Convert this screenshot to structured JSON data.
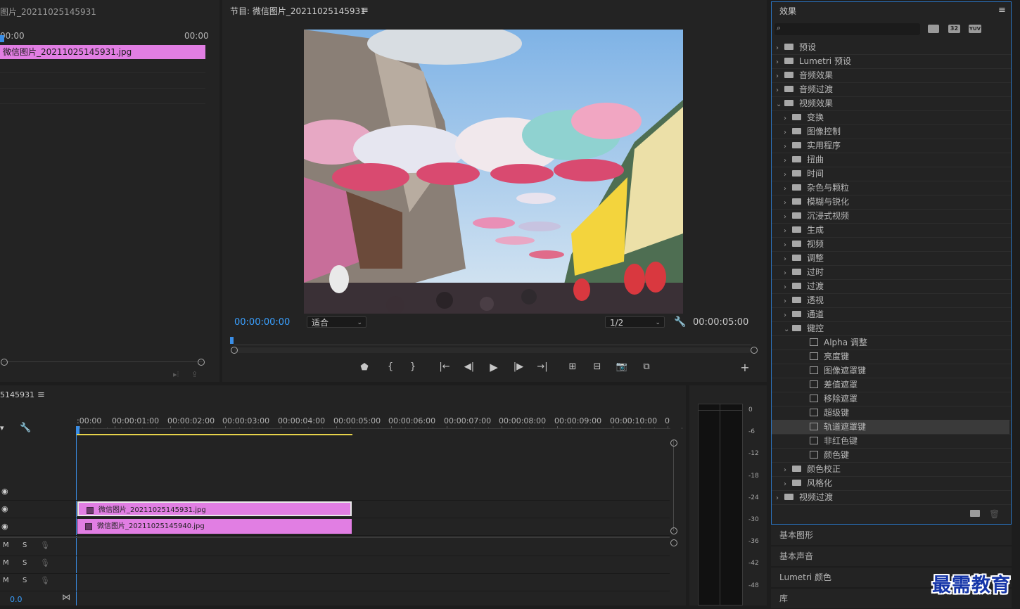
{
  "source_monitor": {
    "title": "图片_20211025145931",
    "tc_start": "00:00",
    "tc_end": "00:00",
    "clip_name": "微信图片_20211025145931.jpg"
  },
  "program_monitor": {
    "title": "节目: 微信图片_20211025145931",
    "current_tc": "00:00:00:00",
    "fit_select": "适合",
    "resolution_select": "1/2",
    "duration_tc": "00:00:05:00"
  },
  "effects_panel": {
    "title": "效果",
    "search_placeholder": "",
    "badges": [
      "32",
      "YUV"
    ],
    "tree": [
      {
        "label": "预设",
        "level": 0,
        "expanded": false,
        "kind": "star-folder"
      },
      {
        "label": "Lumetri 预设",
        "level": 0,
        "expanded": false,
        "kind": "star-folder"
      },
      {
        "label": "音频效果",
        "level": 0,
        "expanded": false,
        "kind": "folder"
      },
      {
        "label": "音频过渡",
        "level": 0,
        "expanded": false,
        "kind": "folder"
      },
      {
        "label": "视频效果",
        "level": 0,
        "expanded": true,
        "kind": "folder"
      },
      {
        "label": "变换",
        "level": 1,
        "expanded": false,
        "kind": "folder"
      },
      {
        "label": "图像控制",
        "level": 1,
        "expanded": false,
        "kind": "folder"
      },
      {
        "label": "实用程序",
        "level": 1,
        "expanded": false,
        "kind": "folder"
      },
      {
        "label": "扭曲",
        "level": 1,
        "expanded": false,
        "kind": "folder"
      },
      {
        "label": "时间",
        "level": 1,
        "expanded": false,
        "kind": "folder"
      },
      {
        "label": "杂色与颗粒",
        "level": 1,
        "expanded": false,
        "kind": "folder"
      },
      {
        "label": "模糊与锐化",
        "level": 1,
        "expanded": false,
        "kind": "folder"
      },
      {
        "label": "沉浸式视频",
        "level": 1,
        "expanded": false,
        "kind": "folder"
      },
      {
        "label": "生成",
        "level": 1,
        "expanded": false,
        "kind": "folder"
      },
      {
        "label": "视频",
        "level": 1,
        "expanded": false,
        "kind": "folder"
      },
      {
        "label": "调整",
        "level": 1,
        "expanded": false,
        "kind": "folder"
      },
      {
        "label": "过时",
        "level": 1,
        "expanded": false,
        "kind": "folder"
      },
      {
        "label": "过渡",
        "level": 1,
        "expanded": false,
        "kind": "folder"
      },
      {
        "label": "透视",
        "level": 1,
        "expanded": false,
        "kind": "folder"
      },
      {
        "label": "通道",
        "level": 1,
        "expanded": false,
        "kind": "folder"
      },
      {
        "label": "键控",
        "level": 1,
        "expanded": true,
        "kind": "folder"
      },
      {
        "label": "Alpha 调整",
        "level": 2,
        "kind": "effect"
      },
      {
        "label": "亮度键",
        "level": 2,
        "kind": "effect"
      },
      {
        "label": "图像遮罩键",
        "level": 2,
        "kind": "effect"
      },
      {
        "label": "差值遮罩",
        "level": 2,
        "kind": "effect"
      },
      {
        "label": "移除遮罩",
        "level": 2,
        "kind": "effect"
      },
      {
        "label": "超级键",
        "level": 2,
        "kind": "effect"
      },
      {
        "label": "轨道遮罩键",
        "level": 2,
        "kind": "effect",
        "selected": true
      },
      {
        "label": "非红色键",
        "level": 2,
        "kind": "effect"
      },
      {
        "label": "颜色键",
        "level": 2,
        "kind": "effect"
      },
      {
        "label": "颜色校正",
        "level": 1,
        "expanded": false,
        "kind": "folder"
      },
      {
        "label": "风格化",
        "level": 1,
        "expanded": false,
        "kind": "folder"
      },
      {
        "label": "视频过渡",
        "level": 0,
        "expanded": false,
        "kind": "folder"
      }
    ]
  },
  "collapsed_panels": [
    "基本图形",
    "基本声音",
    "Lumetri 颜色",
    "库"
  ],
  "timeline": {
    "title": "5145931",
    "ruler": [
      ":00:00",
      "00:00:01:00",
      "00:00:02:00",
      "00:00:03:00",
      "00:00:04:00",
      "00:00:05:00",
      "00:00:06:00",
      "00:00:07:00",
      "00:00:08:00",
      "00:00:09:00",
      "00:00:10:00",
      "0"
    ],
    "clips": [
      {
        "name": "微信图片_20211025145931.jpg"
      },
      {
        "name": "微信图片_20211025145940.jpg"
      }
    ],
    "audio_labels": [
      "M",
      "S"
    ],
    "bottom_value": "0.0"
  },
  "meter": {
    "db_labels": [
      "0",
      "-6",
      "-12",
      "-18",
      "-24",
      "-30",
      "-36",
      "-42",
      "-48"
    ]
  },
  "watermark": "最需教育",
  "colors": {
    "accent_blue": "#3aa0ff",
    "clip_pink": "#e17ee3",
    "panel_bg": "#232323",
    "focus_border": "#2c76c4"
  }
}
